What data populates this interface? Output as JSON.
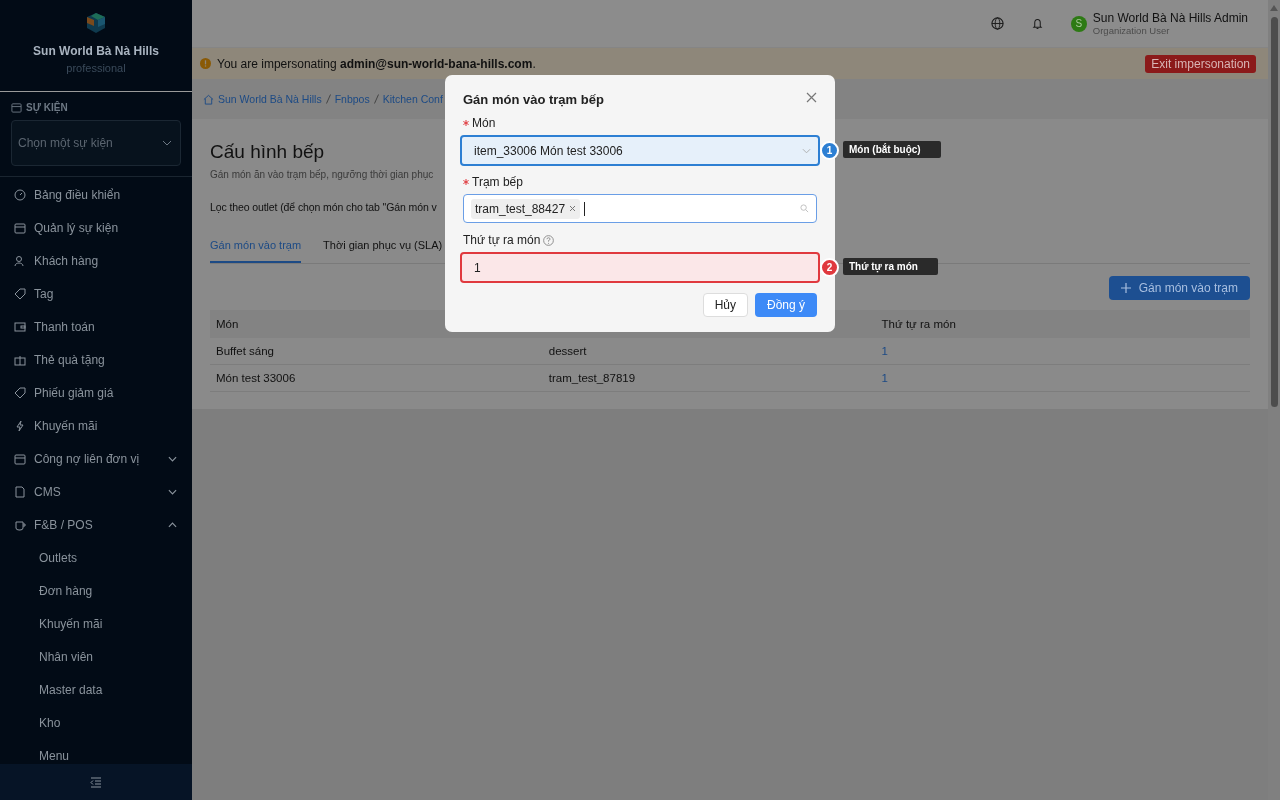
{
  "sidebar": {
    "brand": "Sun World Bà Nà Hills",
    "plan": "professional",
    "event_section": {
      "label": "SỰ KIỆN",
      "placeholder": "Chọn một sự kiện"
    },
    "items": [
      {
        "label": "Bảng điều khiển",
        "kind": "link"
      },
      {
        "label": "Quản lý sự kiện",
        "kind": "link"
      },
      {
        "label": "Khách hàng",
        "kind": "link"
      },
      {
        "label": "Tag",
        "kind": "link"
      },
      {
        "label": "Thanh toán",
        "kind": "link"
      },
      {
        "label": "Thẻ quà tặng",
        "kind": "link"
      },
      {
        "label": "Phiếu giảm giá",
        "kind": "link"
      },
      {
        "label": "Khuyến mãi",
        "kind": "link"
      },
      {
        "label": "Công nợ liên đơn vị",
        "kind": "group",
        "expanded": false
      },
      {
        "label": "CMS",
        "kind": "group",
        "expanded": false
      },
      {
        "label": "F&B / POS",
        "kind": "group",
        "expanded": true,
        "children": [
          {
            "label": "Outlets"
          },
          {
            "label": "Đơn hàng"
          },
          {
            "label": "Khuyến mãi"
          },
          {
            "label": "Nhân viên"
          },
          {
            "label": "Master data"
          },
          {
            "label": "Kho"
          },
          {
            "label": "Menu"
          }
        ]
      }
    ]
  },
  "topbar": {
    "avatar_letter": "S",
    "user_name": "Sun World Bà Nà Hills Admin",
    "user_role": "Organization User"
  },
  "banner": {
    "text": "You are impersonating **admin@sun-world-bana-hills.com**.",
    "button": "Exit impersonation"
  },
  "breadcrumb": [
    "Sun World Bà Nà Hills",
    "Fnbpos",
    "Kitchen Conf"
  ],
  "page": {
    "title": "Cấu hình bếp",
    "subtitle": "Gán món ăn vào trạm bếp, ngưỡng thời gian phục",
    "filter_label": "Lọc theo outlet (để chọn món cho tab \"Gán món v",
    "tabs": [
      {
        "label": "Gán món vào trạm",
        "selected": true
      },
      {
        "label": "Thời gian phục vụ (SLA)",
        "selected": false
      }
    ],
    "add_button": "Gán món vào trạm",
    "table": {
      "columns": [
        {
          "label": "Món"
        },
        {},
        {
          "label": "Thứ tự ra món"
        }
      ],
      "rows": [
        [
          "Buffet sáng",
          "dessert",
          "1"
        ],
        [
          "Món test 33006",
          "tram_test_87819",
          "1"
        ]
      ]
    }
  },
  "dialog": {
    "title": "Gán món vào trạm bếp",
    "fields": [
      {
        "kind": "select",
        "label": "Món",
        "required": true,
        "help": false,
        "value": "item_33006 Món test 33006",
        "highlight": {
          "number": "1",
          "label": "Món (bắt buộc)",
          "color": "#2d7fd3"
        }
      },
      {
        "kind": "tags",
        "label": "Trạm bếp",
        "required": true,
        "help": false,
        "tags": [
          "tram_test_88427"
        ]
      },
      {
        "kind": "number",
        "label": "Thứ tự ra món",
        "required": false,
        "help": true,
        "value": "1",
        "highlight": {
          "number": "2",
          "label": "Thứ tự ra món",
          "color": "#e0393e"
        }
      }
    ],
    "cancel": "Hủy",
    "ok": "Đồng ý"
  }
}
